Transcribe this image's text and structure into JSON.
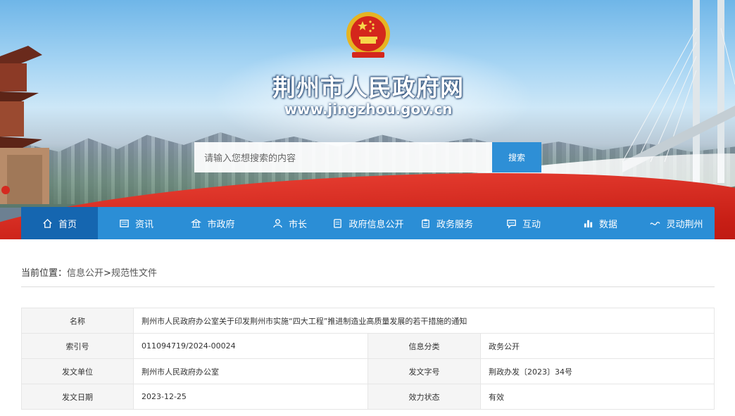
{
  "header": {
    "site_title": "荆州市人民政府网",
    "site_url": "www.jingzhou.gov.cn",
    "search_placeholder": "请输入您想搜索的内容",
    "search_button": "搜索"
  },
  "nav": {
    "items": [
      {
        "label": "首页",
        "icon": "home-icon",
        "active": true
      },
      {
        "label": "资讯",
        "icon": "news-icon"
      },
      {
        "label": "市政府",
        "icon": "government-icon"
      },
      {
        "label": "市长",
        "icon": "person-icon"
      },
      {
        "label": "政府信息公开",
        "icon": "document-icon"
      },
      {
        "label": "政务服务",
        "icon": "clipboard-icon"
      },
      {
        "label": "互动",
        "icon": "chat-icon"
      },
      {
        "label": "数据",
        "icon": "bar-chart-icon"
      },
      {
        "label": "灵动荆州",
        "icon": "wave-icon"
      }
    ]
  },
  "breadcrumb": {
    "prefix": "当前位置：",
    "link1": "信息公开",
    "separator": ">",
    "link2": "规范性文件"
  },
  "info_table": {
    "name_label": "名称",
    "name_value": "荆州市人民政府办公室关于印发荆州市实施“四大工程”推进制造业高质量发展的若干措施的通知",
    "index_label": "索引号",
    "index_value": "011094719/2024-00024",
    "category_label": "信息分类",
    "category_value": "政务公开",
    "issuer_label": "发文单位",
    "issuer_value": "荆州市人民政府办公室",
    "docno_label": "发文字号",
    "docno_value": "荆政办发〔2023〕34号",
    "date_label": "发文日期",
    "date_value": "2023-12-25",
    "status_label": "效力状态",
    "status_value": "有效"
  },
  "colors": {
    "nav_bg": "#2b8ed6",
    "nav_active": "#1566b0",
    "search_button": "#2e8fd6",
    "banner_red": "#d42a20"
  }
}
